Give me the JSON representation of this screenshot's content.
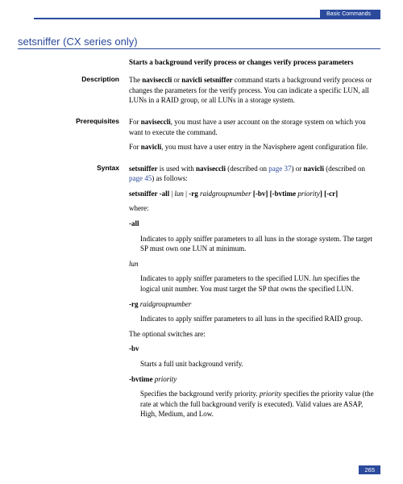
{
  "header": {
    "section": "Basic Commands"
  },
  "title": "setsniffer (CX series only)",
  "subtitle": "Starts a background verify process or changes verify process parameters",
  "description": {
    "label": "Description",
    "p1a": "The ",
    "p1b": "naviseccli",
    "p1c": " or ",
    "p1d": "navicli setsniffer",
    "p1e": " command starts a background verify process or changes the parameters for the verify process. You can indicate a specific LUN, all LUNs in a RAID group, or all LUNs in a storage system."
  },
  "prerequisites": {
    "label": "Prerequisites",
    "p1a": "For ",
    "p1b": "naviseccli",
    "p1c": ", you must have a user account on the storage system on which you want to execute the command.",
    "p2a": "For ",
    "p2b": "navicli",
    "p2c": ", you must have a user entry in the Navisphere agent configuration file."
  },
  "syntax": {
    "label": "Syntax",
    "p1a": "setsniffer",
    "p1b": " is used with ",
    "p1c": "naviseccli",
    "p1d": " (described on ",
    "p1e": "page 37",
    "p1f": ") or ",
    "p1g": "navicli",
    "p1h": " (described on ",
    "p1i": "page 45",
    "p1j": ") as follows:",
    "usage_a": "setsniffer  -all",
    "usage_b": " | ",
    "usage_c": "lun",
    "usage_d": " | ",
    "usage_e": "-rg",
    "usage_f": " raidgroupnumber  ",
    "usage_g": "[-bv]  [-bvtime",
    "usage_h": " priority",
    "usage_i": "]  [-cr]",
    "where": "where:",
    "all_hdr": "-all",
    "all_txt": "Indicates to apply sniffer parameters to all luns in the storage system. The target SP must own one LUN at minimum.",
    "lun_hdr": "lun",
    "lun_txt_a": "Indicates to apply sniffer parameters to the specified LUN. ",
    "lun_txt_b": "lun",
    "lun_txt_c": " specifies the logical unit number. You must target the SP that owns the specified LUN.",
    "rg_hdr_a": "-rg",
    "rg_hdr_b": " raidgroupnumber",
    "rg_txt": "Indicates to apply sniffer parameters to all luns in the specified RAID group.",
    "optional": "The optional switches are:",
    "bv_hdr": "-bv",
    "bv_txt": "Starts a full unit background verify.",
    "bvtime_hdr_a": "-bvtime",
    "bvtime_hdr_b": " priority",
    "bvtime_txt_a": "Specifies the background verify priority. ",
    "bvtime_txt_b": "priority",
    "bvtime_txt_c": " specifies the priority value (the rate at which the full background verify is executed). Valid values are ASAP, High, Medium, and Low."
  },
  "page": "265"
}
